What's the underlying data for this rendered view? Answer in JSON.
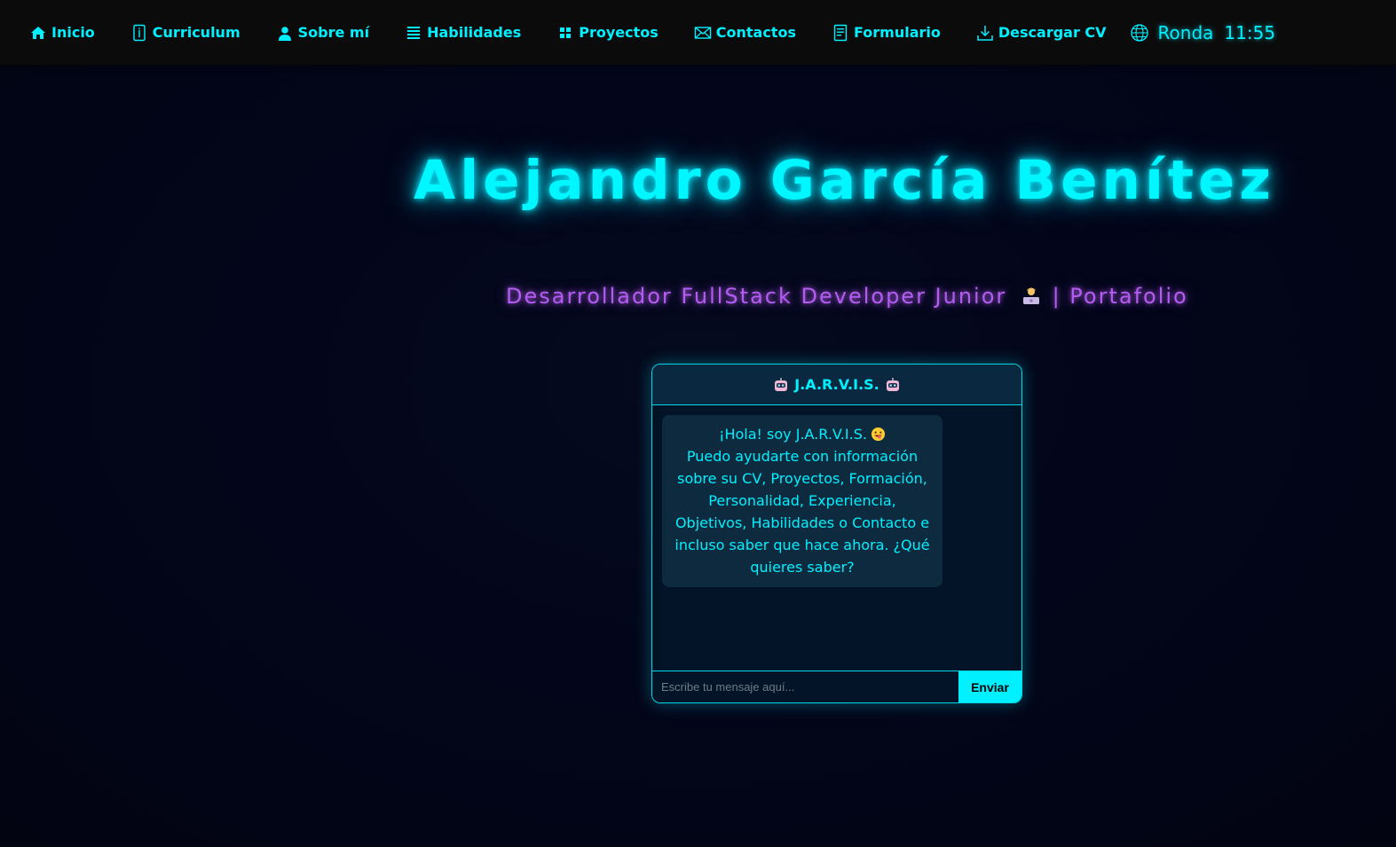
{
  "nav": {
    "items": [
      {
        "label": "Inicio",
        "icon": "home-icon"
      },
      {
        "label": "Curriculum",
        "icon": "info-icon"
      },
      {
        "label": "Sobre mí",
        "icon": "person-icon"
      },
      {
        "label": "Habilidades",
        "icon": "list-icon"
      },
      {
        "label": "Proyectos",
        "icon": "grid-icon"
      },
      {
        "label": "Contactos",
        "icon": "mail-icon"
      },
      {
        "label": "Formulario",
        "icon": "document-icon"
      },
      {
        "label": "Descargar CV",
        "icon": "download-icon"
      }
    ],
    "clock": {
      "location": "Ronda",
      "time": "11:55",
      "icon": "globe-icon"
    }
  },
  "hero": {
    "title": "Alejandro García Benítez",
    "subtitle_text": "Desarrollador FullStack Developer Junior",
    "subtitle_suffix": "| Portafolio"
  },
  "chat": {
    "title": "J.A.R.V.I.S.",
    "greeting": "¡Hola! soy J.A.R.V.I.S.",
    "message": "Puedo ayudarte con información sobre su CV, Proyectos, Formación, Personalidad, Experiencia, Objetivos, Habilidades o Contacto e incluso saber que hace ahora. ¿Qué quieres saber?",
    "input_placeholder": "Escribe tu mensaje aquí...",
    "send_label": "Enviar"
  },
  "colors": {
    "accent": "#00f0ff",
    "subtitle": "#b25cf0",
    "topbar": "#0b0b0b",
    "background": "#03061a"
  }
}
